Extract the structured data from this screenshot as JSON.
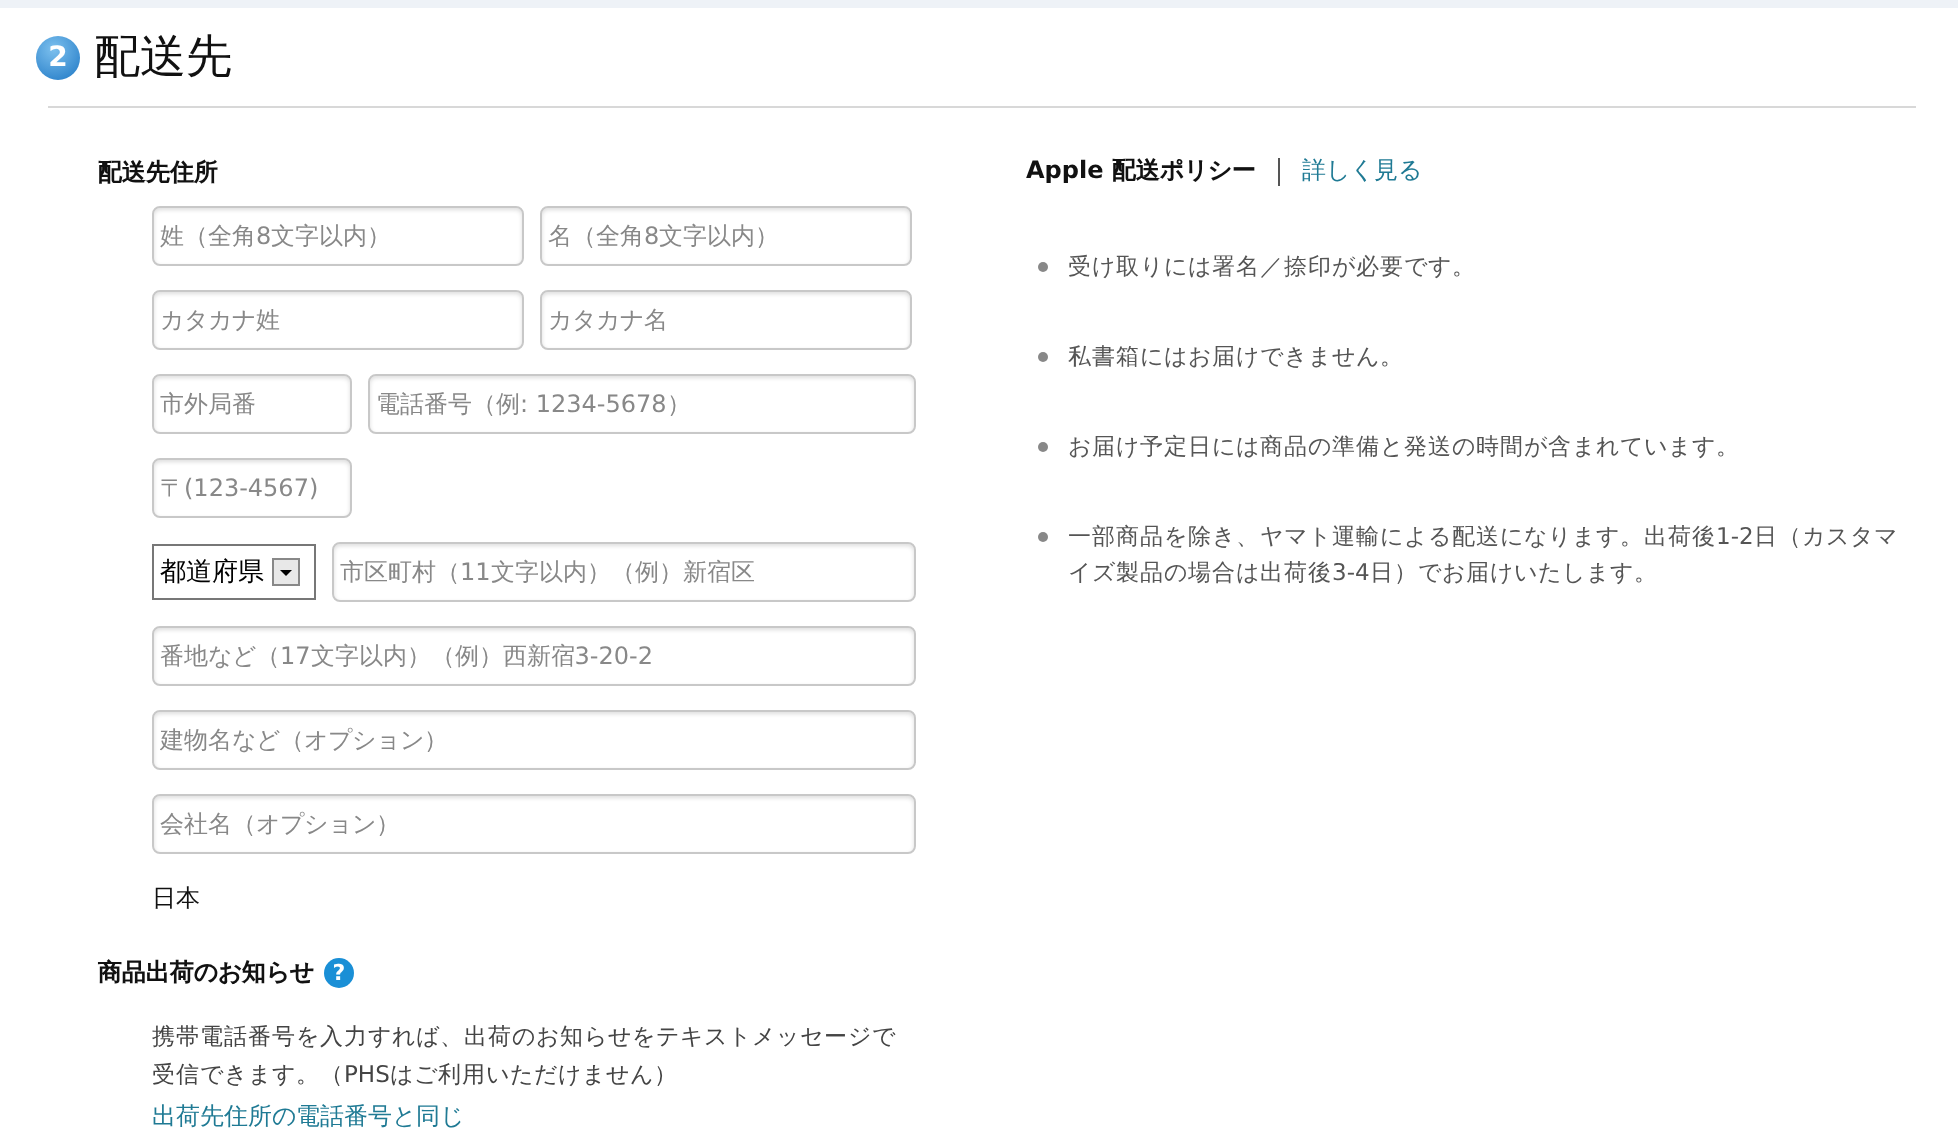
{
  "step": {
    "number": "2",
    "title": "配送先"
  },
  "address": {
    "heading": "配送先住所",
    "rows": [
      [
        {
          "kind": "half",
          "placeholder": "姓（全角8文字以内）"
        },
        {
          "kind": "half",
          "placeholder": "名（全角8文字以内）"
        }
      ],
      [
        {
          "kind": "half",
          "placeholder": "カタカナ姓"
        },
        {
          "kind": "half",
          "placeholder": "カタカナ名"
        }
      ],
      [
        {
          "kind": "short",
          "placeholder": "市外局番"
        },
        {
          "kind": "fill",
          "placeholder": "電話番号（例: 1234-5678）"
        }
      ],
      [
        {
          "kind": "short",
          "placeholder": "〒(123-4567)"
        }
      ],
      [
        {
          "kind": "select",
          "value": "都道府県"
        },
        {
          "kind": "fill",
          "placeholder": "市区町村（11文字以内）（例）新宿区"
        }
      ],
      [
        {
          "kind": "fill",
          "placeholder": "番地など（17文字以内）（例）西新宿3-20-2"
        }
      ],
      [
        {
          "kind": "fill",
          "placeholder": "建物名など（オプション）"
        }
      ],
      [
        {
          "kind": "fill",
          "placeholder": "会社名（オプション）"
        }
      ]
    ],
    "country": "日本"
  },
  "notification": {
    "heading": "商品出荷のお知らせ",
    "help": "?",
    "text": "携帯電話番号を入力すれば、出荷のお知らせをテキストメッセージで受信できます。（PHSはご利用いただけません）",
    "link": "出荷先住所の電話番号と同じ"
  },
  "policy": {
    "title": "Apple 配送ポリシー",
    "link": "詳しく見る",
    "items": [
      "受け取りには署名／捺印が必要です。",
      "私書箱にはお届けできません。",
      "お届け予定日には商品の準備と発送の時間が含まれています。",
      "一部商品を除き、ヤマト運輸による配送になります。出荷後1-2日（カスタマイズ製品の場合は出荷後3-4日）でお届けいたします。"
    ]
  }
}
